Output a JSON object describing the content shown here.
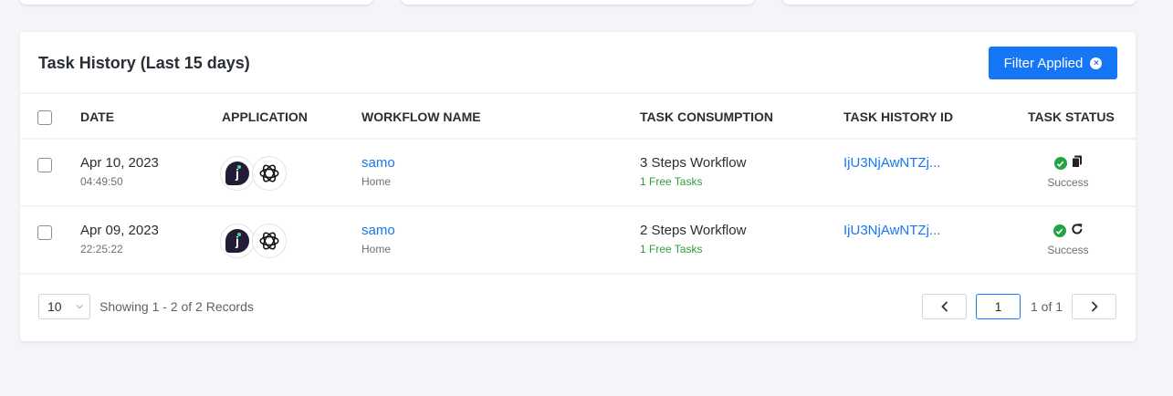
{
  "card": {
    "title": "Task History (Last 15 days)",
    "filter_label": "Filter Applied"
  },
  "table": {
    "headers": [
      "DATE",
      "APPLICATION",
      "WORKFLOW NAME",
      "TASK CONSUMPTION",
      "TASK HISTORY ID",
      "TASK STATUS"
    ],
    "rows": [
      {
        "date": "Apr 10, 2023",
        "time": "04:49:50",
        "apps": [
          "j-app-icon",
          "openai-icon"
        ],
        "workflow": "samo",
        "folder": "Home",
        "consumption": "3 Steps Workflow",
        "free_tasks": "1 Free Tasks",
        "history_id": "IjU3NjAwNTZj...",
        "status": "Success",
        "action_icon": "document-icon"
      },
      {
        "date": "Apr 09, 2023",
        "time": "22:25:22",
        "apps": [
          "j-app-icon",
          "openai-icon"
        ],
        "workflow": "samo",
        "folder": "Home",
        "consumption": "2 Steps Workflow",
        "free_tasks": "1 Free Tasks",
        "history_id": "IjU3NjAwNTZj...",
        "status": "Success",
        "action_icon": "retry-icon"
      }
    ]
  },
  "footer": {
    "page_size": "10",
    "showing": "Showing 1 - 2 of 2 Records",
    "current_page": "1",
    "page_of": "1 of 1"
  },
  "colors": {
    "accent": "#1677f6",
    "success": "#25a244",
    "free_tasks": "#2e9e3f"
  }
}
